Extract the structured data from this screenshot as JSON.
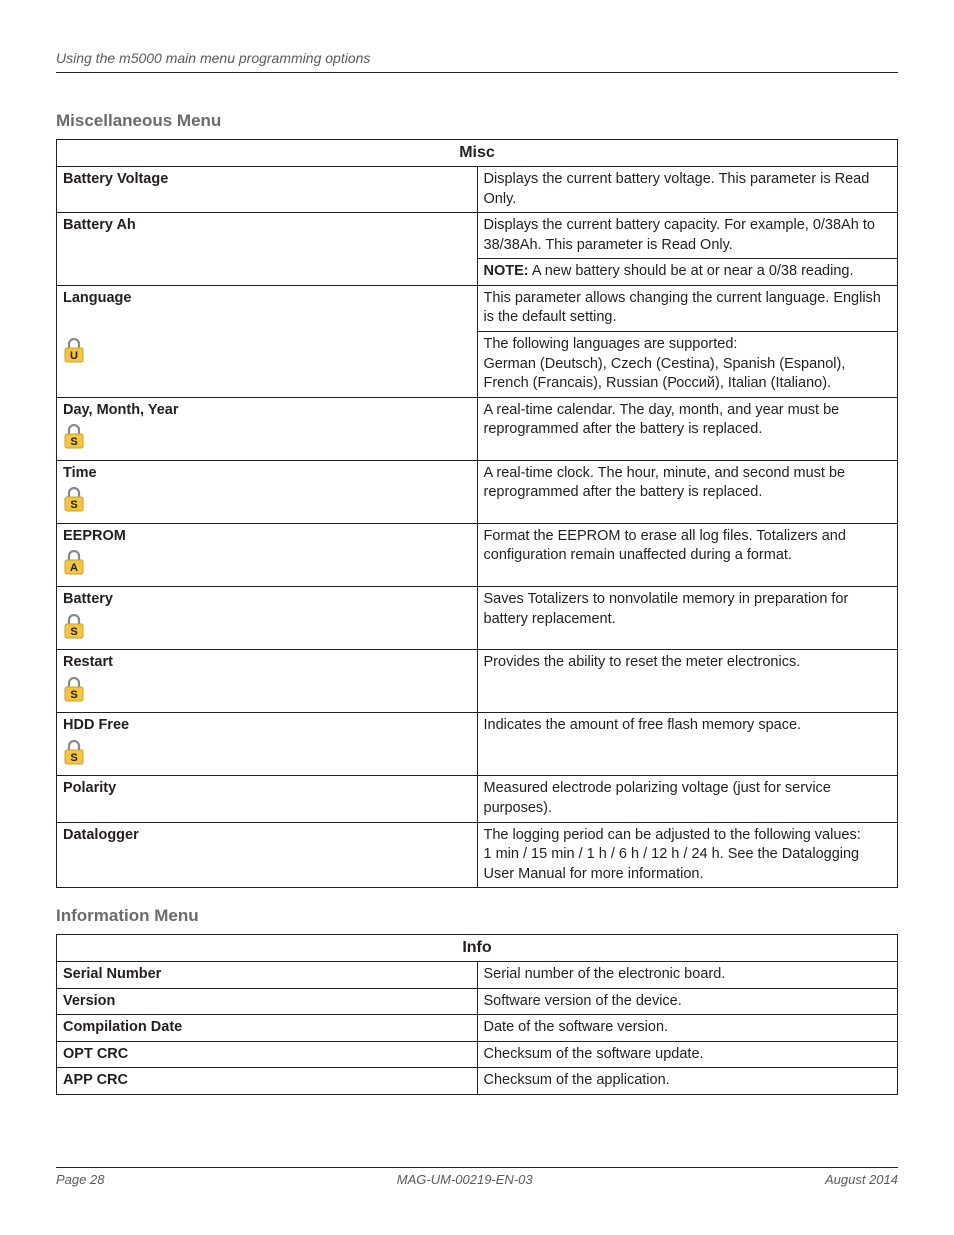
{
  "running_header": "Using the m5000 main menu programming options",
  "sections": {
    "misc": {
      "heading": "Miscellaneous Menu",
      "table_title": "Misc",
      "rows": [
        {
          "label": "Battery Voltage",
          "icon": null,
          "desc": [
            [
              "",
              "Displays the current battery voltage. This parameter is Read Only."
            ]
          ]
        },
        {
          "label": "Battery Ah",
          "icon": null,
          "desc": [
            [
              "",
              "Displays the current battery capacity. For example, 0/38Ah to 38/38Ah. This parameter is Read Only."
            ]
          ],
          "cont": [
            [
              "NOTE:",
              "  A new battery should be at or near a 0/38 reading."
            ]
          ]
        },
        {
          "label": "Language",
          "icon": "U",
          "desc": [
            [
              "",
              "This parameter allows changing the current language. English is the default setting."
            ]
          ],
          "cont2": [
            [
              "",
              "The following languages are supported:"
            ],
            [
              "",
              "German (Deutsch), Czech (Cestina), Spanish (Espanol), French (Francais), Russian (Россий), Italian (Italiano)."
            ]
          ]
        },
        {
          "label": "Day, Month, Year",
          "icon": "S",
          "desc": [
            [
              "",
              "A real-time calendar. The day, month, and year must be reprogrammed after the battery is replaced."
            ]
          ]
        },
        {
          "label": "Time",
          "icon": "S",
          "desc": [
            [
              "",
              "A real-time clock. The hour, minute, and second must be reprogrammed after the battery is replaced."
            ]
          ]
        },
        {
          "label": "EEPROM",
          "icon": "A",
          "desc": [
            [
              "",
              "Format the EEPROM to erase all log files. Totalizers and configuration remain unaffected during a format."
            ]
          ]
        },
        {
          "label": "Battery",
          "icon": "S",
          "desc": [
            [
              "",
              "Saves Totalizers to nonvolatile memory in preparation for battery replacement."
            ]
          ]
        },
        {
          "label": "Restart",
          "icon": "S",
          "desc": [
            [
              "",
              "Provides the ability to reset the meter electronics."
            ]
          ]
        },
        {
          "label": "HDD Free",
          "icon": "S",
          "desc": [
            [
              "",
              "Indicates the amount of free flash memory space."
            ]
          ]
        },
        {
          "label": "Polarity",
          "icon": null,
          "desc": [
            [
              "",
              "Measured electrode polarizing voltage (just for service purposes)."
            ]
          ]
        },
        {
          "label": "Datalogger",
          "icon": null,
          "desc": [
            [
              "",
              "The logging period can be adjusted to the following values:"
            ],
            [
              "",
              "1 min / 15 min / 1 h / 6 h / 12 h / 24 h. See the Datalogging User Manual for more information."
            ]
          ]
        }
      ]
    },
    "info": {
      "heading": "Information Menu",
      "table_title": "Info",
      "rows": [
        {
          "label": "Serial Number",
          "desc": "Serial number of the electronic board."
        },
        {
          "label": "Version",
          "desc": "Software version of the device."
        },
        {
          "label": "Compilation Date",
          "desc": "Date of the software version."
        },
        {
          "label": "OPT CRC",
          "desc": "Checksum of the software update."
        },
        {
          "label": "APP CRC",
          "desc": "Checksum of the application."
        }
      ]
    }
  },
  "icon_colors": {
    "U": "#f5c542",
    "S": "#f5c542",
    "A": "#f5c542"
  },
  "footer": {
    "left": "Page 28",
    "center": "MAG-UM-00219-EN-03",
    "right": "August 2014"
  }
}
